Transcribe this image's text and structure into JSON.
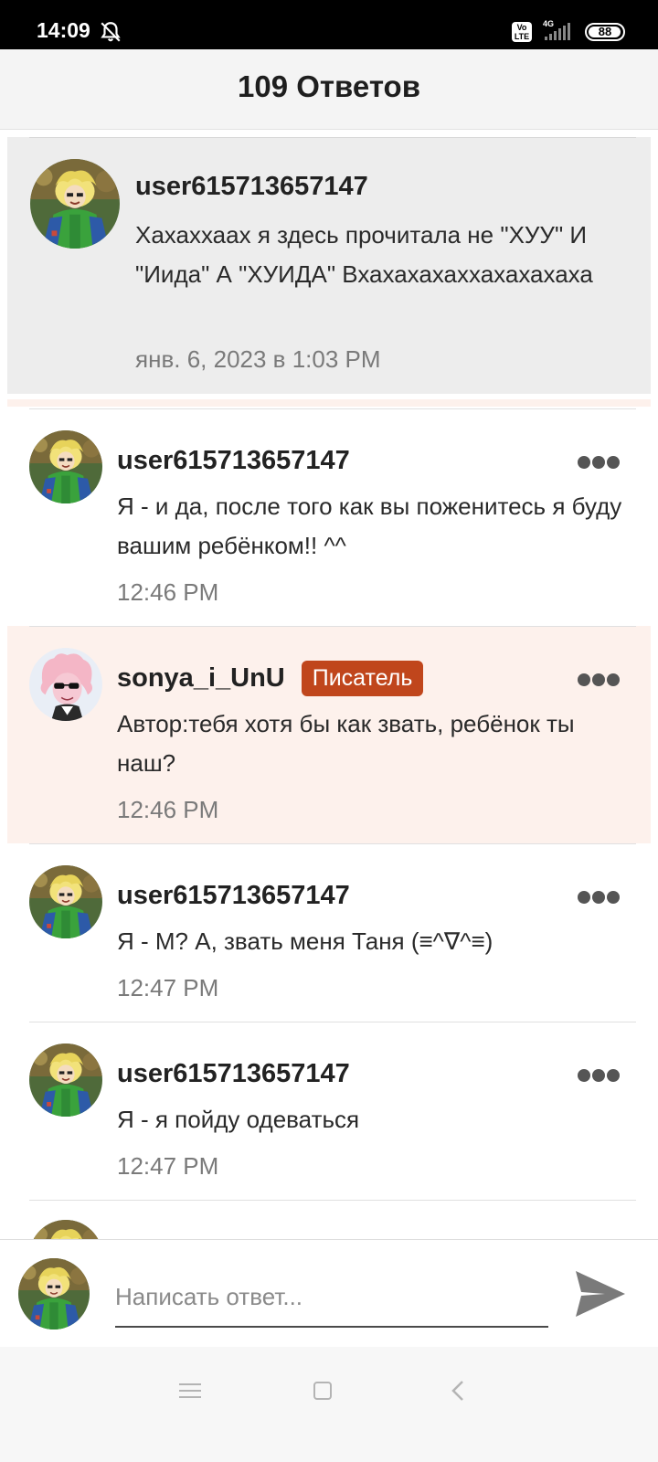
{
  "status_bar": {
    "time": "14:09",
    "volte_label": "Vo LTE",
    "network": "4G",
    "battery": "88"
  },
  "header": {
    "title": "109 Ответов"
  },
  "main_comment": {
    "username": "user615713657147",
    "text": "Хахаххаах я здесь прочитала не \"ХУУ\" И \"Иида\" А \"ХУИДА\" Вхахахахаххахахахаха",
    "date": "янв. 6, 2023 в 1:03 PM"
  },
  "replies": [
    {
      "username": "user615713657147",
      "text": "Я - и да, после того как вы поженитесь я буду вашим ребёнком!! ^^",
      "time": "12:46 PM"
    },
    {
      "username": "sonya_i_UnU",
      "badge": "Писатель",
      "text": "Автор:тебя хотя бы как звать, ребёнок ты наш?",
      "time": "12:46 PM"
    },
    {
      "username": "user615713657147",
      "text": "Я - М? А, звать меня Таня (≡^∇^≡)",
      "time": "12:47 PM"
    },
    {
      "username": "user615713657147",
      "text": "Я - я пойду одеваться",
      "time": "12:47 PM"
    }
  ],
  "composer": {
    "placeholder": "Написать ответ..."
  },
  "colors": {
    "badge": "#c0461c",
    "highlight_row": "#fdf1ec",
    "main_comment_bg": "#ededed"
  },
  "icons": {
    "more": "more-dots-icon",
    "send": "send-icon",
    "mute": "bell-off-icon"
  }
}
